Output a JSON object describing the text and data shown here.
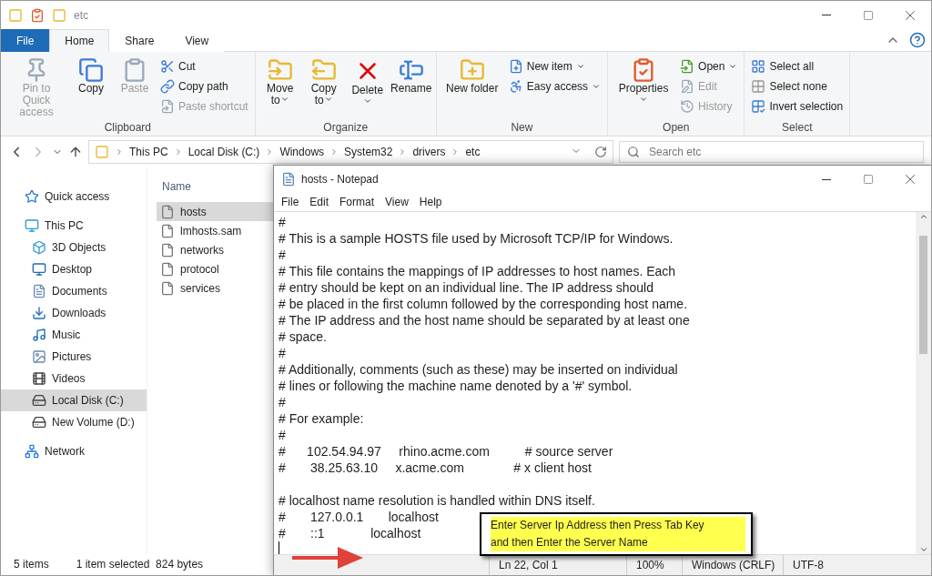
{
  "window": {
    "title": "etc"
  },
  "ribbon_tabs": [
    {
      "label": "File",
      "kind": "file",
      "selected": false
    },
    {
      "label": "Home",
      "kind": "tab",
      "selected": true
    },
    {
      "label": "Share",
      "kind": "tab",
      "selected": false
    },
    {
      "label": "View",
      "kind": "tab",
      "selected": false
    }
  ],
  "ribbon_groups": [
    {
      "name": "Clipboard",
      "items": [
        {
          "label": "Pin to Quick access",
          "kind": "large",
          "disabled": true,
          "menu": false
        },
        {
          "label": "Copy",
          "kind": "large",
          "disabled": false,
          "menu": false
        },
        {
          "label": "Paste",
          "kind": "large",
          "disabled": true,
          "menu": false
        },
        {
          "kind": "stack",
          "items": [
            {
              "label": "Cut",
              "disabled": false,
              "menu": false
            },
            {
              "label": "Copy path",
              "disabled": false,
              "menu": false
            },
            {
              "label": "Paste shortcut",
              "disabled": true,
              "menu": false
            }
          ]
        }
      ]
    },
    {
      "name": "Organize",
      "items": [
        {
          "label": "Move to",
          "kind": "large",
          "disabled": false,
          "menu": true
        },
        {
          "label": "Copy to",
          "kind": "large",
          "disabled": false,
          "menu": true
        },
        {
          "label": "Delete",
          "kind": "large",
          "disabled": false,
          "menu": true
        },
        {
          "label": "Rename",
          "kind": "large",
          "disabled": false,
          "menu": false
        }
      ]
    },
    {
      "name": "New",
      "items": [
        {
          "label": "New folder",
          "kind": "large",
          "disabled": false,
          "menu": false
        },
        {
          "kind": "stack",
          "items": [
            {
              "label": "New item",
              "disabled": false,
              "menu": true
            },
            {
              "label": "Easy access",
              "disabled": false,
              "menu": true
            }
          ]
        }
      ]
    },
    {
      "name": "Open",
      "items": [
        {
          "label": "Properties",
          "kind": "large",
          "disabled": false,
          "menu": true
        },
        {
          "kind": "stack",
          "items": [
            {
              "label": "Open",
              "disabled": false,
              "menu": true
            },
            {
              "label": "Edit",
              "disabled": true,
              "menu": false
            },
            {
              "label": "History",
              "disabled": true,
              "menu": false
            }
          ]
        }
      ]
    },
    {
      "name": "Select",
      "items": [
        {
          "kind": "stack",
          "items": [
            {
              "label": "Select all",
              "disabled": false,
              "menu": false
            },
            {
              "label": "Select none",
              "disabled": false,
              "menu": false
            },
            {
              "label": "Invert selection",
              "disabled": false,
              "menu": false
            }
          ]
        }
      ]
    }
  ],
  "breadcrumb": [
    "This PC",
    "Local Disk (C:)",
    "Windows",
    "System32",
    "drivers",
    "etc"
  ],
  "search": {
    "placeholder": "Search etc"
  },
  "sidebar": [
    {
      "label": "Quick access",
      "selected": false
    },
    {
      "label": "This PC",
      "selected": false,
      "children": [
        {
          "label": "3D Objects",
          "selected": false
        },
        {
          "label": "Desktop",
          "selected": false
        },
        {
          "label": "Documents",
          "selected": false
        },
        {
          "label": "Downloads",
          "selected": false
        },
        {
          "label": "Music",
          "selected": false
        },
        {
          "label": "Pictures",
          "selected": false
        },
        {
          "label": "Videos",
          "selected": false
        },
        {
          "label": "Local Disk (C:)",
          "selected": true
        },
        {
          "label": "New Volume (D:)",
          "selected": false
        }
      ]
    },
    {
      "label": "Network",
      "selected": false
    }
  ],
  "file_list": {
    "column": "Name",
    "files": [
      {
        "name": "hosts",
        "selected": true
      },
      {
        "name": "lmhosts.sam",
        "selected": false
      },
      {
        "name": "networks",
        "selected": false
      },
      {
        "name": "protocol",
        "selected": false
      },
      {
        "name": "services",
        "selected": false
      }
    ]
  },
  "status_bar": {
    "items": "5 items",
    "selection": "1 item selected  824 bytes"
  },
  "notepad": {
    "title": "hosts - Notepad",
    "menu": [
      "File",
      "Edit",
      "Format",
      "View",
      "Help"
    ],
    "blocks": [
      [
        "#",
        "# This is a sample HOSTS file used by Microsoft TCP/IP for Windows.",
        "#",
        "# This file contains the mappings of IP addresses to host names. Each",
        "# entry should be kept on an individual line. The IP address should",
        "# be placed in the first column followed by the corresponding host name.",
        "# The IP address and the host name should be separated by at least one",
        "# space.",
        "#",
        "# Additionally, comments (such as these) may be inserted on individual",
        "# lines or following the machine name denoted by a '#' symbol.",
        "#",
        "# For example:",
        "#",
        "#      102.54.94.97     rhino.acme.com          # source server",
        "#       38.25.63.10     x.acme.com              # x client host"
      ],
      [
        "# localhost name resolution is handled within DNS itself.",
        "#\t127.0.0.1       localhost",
        "#\t::1             localhost"
      ]
    ],
    "status": [
      "Ln 22, Col 1",
      "100%",
      "Windows (CRLF)",
      "UTF-8"
    ]
  },
  "callout": {
    "lines": [
      "Enter Server Ip Address then Press Tab Key",
      "and then Enter the Server Name"
    ]
  }
}
